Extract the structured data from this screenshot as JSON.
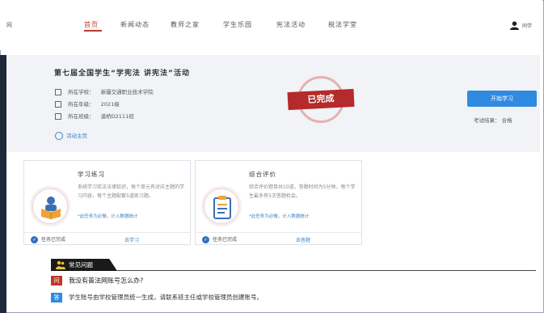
{
  "header": {
    "logo_text": "网",
    "nav": [
      {
        "label": "首页",
        "active": true
      },
      {
        "label": "新闻动态",
        "active": false
      },
      {
        "label": "教师之家",
        "active": false
      },
      {
        "label": "学生乐园",
        "active": false
      },
      {
        "label": "宪法活动",
        "active": false
      },
      {
        "label": "税法学堂",
        "active": false
      }
    ],
    "user_name": "同学"
  },
  "activity": {
    "title": "第七届全国学生“学宪法 讲宪法”活动",
    "school_label": "所在学校：",
    "school_value": "新疆交通职业技术学院",
    "grade_label": "所在年级：",
    "grade_value": "2021级",
    "class_label": "所在班级：",
    "class_value": "道桥D2111班",
    "link_label": "活动主页",
    "stamp_text": "已完成",
    "start_button": "开始学习",
    "exam_result_label": "考试结果：",
    "exam_result_value": "合格"
  },
  "cards": [
    {
      "title": "学习练习",
      "desc": "系统学习宪法法律知识，每个单元有对应主题的学习内容，每个主题配套5道练习题。",
      "note": "*此任务为必做，计入数据统计",
      "status": "任务已完成",
      "action": "去学习",
      "icon": "reading-icon"
    },
    {
      "title": "综合评价",
      "desc": "综合评价题目共10道，答题时间为5分钟，每个学生最多有5次答题机会。",
      "note": "*此任务为必做，计入数据统计",
      "status": "任务已完成",
      "action": "去答题",
      "icon": "clipboard-icon"
    }
  ],
  "faq": {
    "heading": "常见问题",
    "q_tag": "问",
    "question": "我没有普法网账号怎么办?",
    "a_tag": "答",
    "answer": "学生账号由学校管理员统一生成，请联系班主任或学校管理员创建账号。"
  },
  "colors": {
    "accent_red": "#c0392b",
    "primary_blue": "#2f8ae0",
    "dark_bar": "#1e2a3b"
  }
}
